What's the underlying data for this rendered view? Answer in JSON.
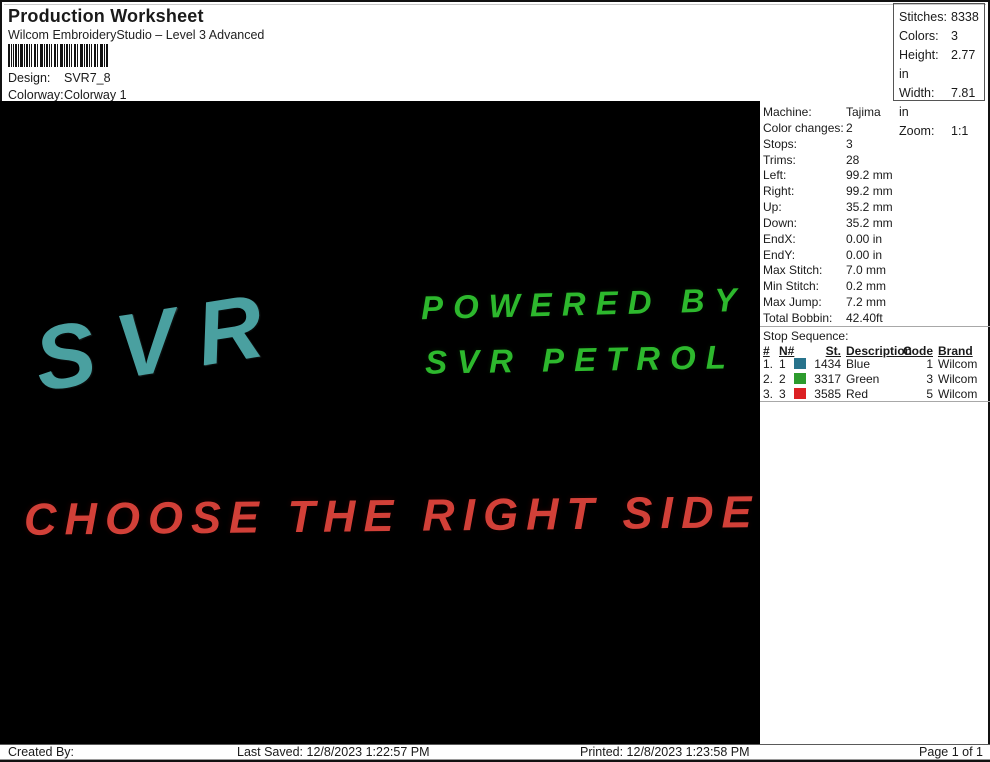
{
  "header": {
    "title": "Production Worksheet",
    "subtitle": "Wilcom EmbroideryStudio – Level 3 Advanced",
    "barcode_icon": "barcode",
    "design_label": "Design:",
    "design_value": "SVR7_8",
    "colorway_label": "Colorway:",
    "colorway_value": "Colorway 1"
  },
  "stats_box": {
    "rows": [
      {
        "label": "Stitches:",
        "value": "8338"
      },
      {
        "label": "Colors:",
        "value": "3"
      },
      {
        "label": "Height:",
        "value": "2.77 in"
      },
      {
        "label": "Width:",
        "value": "7.81 in"
      },
      {
        "label": "Zoom:",
        "value": "1:1"
      }
    ]
  },
  "machine_info": {
    "rows": [
      {
        "label": "Machine:",
        "value": "Tajima"
      },
      {
        "label": "Color changes:",
        "value": "2"
      },
      {
        "label": "Stops:",
        "value": "3"
      },
      {
        "label": "Trims:",
        "value": "28"
      },
      {
        "label": "Left:",
        "value": "99.2 mm"
      },
      {
        "label": "Right:",
        "value": "99.2 mm"
      },
      {
        "label": "Up:",
        "value": "35.2 mm"
      },
      {
        "label": "Down:",
        "value": "35.2 mm"
      },
      {
        "label": "EndX:",
        "value": "0.00 in"
      },
      {
        "label": "EndY:",
        "value": "0.00 in"
      },
      {
        "label": "Max Stitch:",
        "value": "7.0 mm"
      },
      {
        "label": "Min Stitch:",
        "value": "0.2 mm"
      },
      {
        "label": "Max Jump:",
        "value": "7.2 mm"
      },
      {
        "label": "Total Bobbin:",
        "value": "42.40ft"
      }
    ]
  },
  "stop_sequence": {
    "title": "Stop Sequence:",
    "headers": {
      "num": "#",
      "n": "N#",
      "st": "St.",
      "description": "Description",
      "code": "Code",
      "brand": "Brand"
    },
    "rows": [
      {
        "num": "1.",
        "n": "1",
        "swatch_color": "#28738c",
        "swatch_style": "background:#28738c",
        "st": "1434",
        "description": "Blue",
        "code": "1",
        "brand": "Wilcom"
      },
      {
        "num": "2.",
        "n": "2",
        "swatch_color": "#2d9b2d",
        "swatch_style": "background:#2d9b2d",
        "st": "3317",
        "description": "Green",
        "code": "3",
        "brand": "Wilcom"
      },
      {
        "num": "3.",
        "n": "3",
        "swatch_color": "#dc2023",
        "swatch_style": "background:#dc2023",
        "st": "3585",
        "description": "Red",
        "code": "5",
        "brand": "Wilcom"
      }
    ]
  },
  "design_preview": {
    "background_color": "#000000",
    "texts": [
      {
        "content": "SVR",
        "color": "#4aa0a0",
        "style": "color:#4aa0a0"
      },
      {
        "content": "POWERED BY",
        "color": "#2db82d",
        "style": "color:#2db82d"
      },
      {
        "content": "SVR PETROL",
        "color": "#2db82d",
        "style": "color:#2db82d"
      },
      {
        "content": "CHOOSE THE RIGHT SIDE",
        "color": "#d24038",
        "style": "color:#d24038"
      }
    ]
  },
  "footer": {
    "created_by": "Created By:",
    "last_saved": "Last Saved: 12/8/2023 1:22:57 PM",
    "printed": "Printed: 12/8/2023 1:23:58 PM",
    "page": "Page 1 of 1"
  }
}
